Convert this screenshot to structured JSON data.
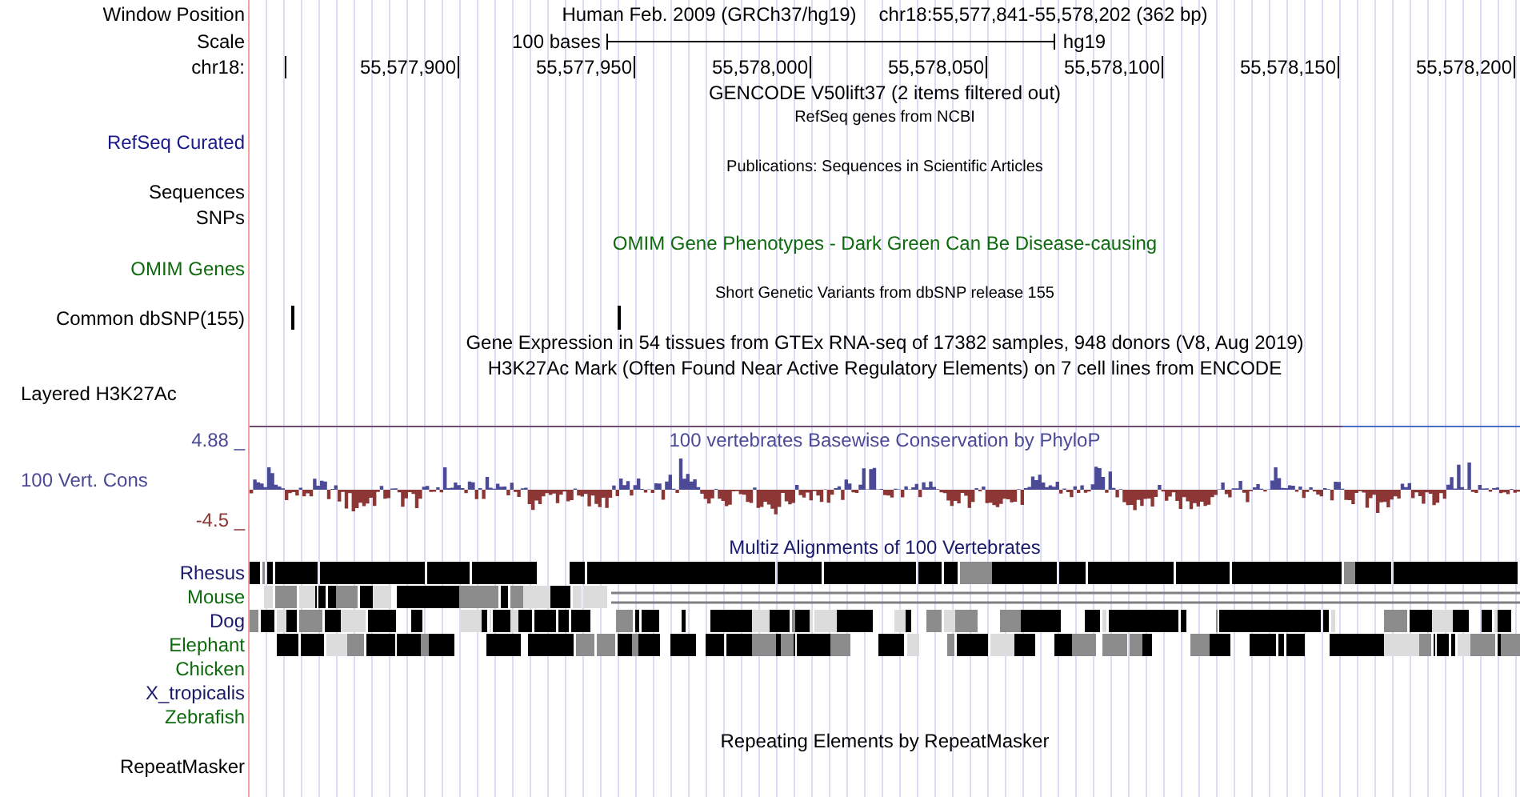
{
  "header": {
    "label": "Window Position",
    "assembly": "Human Feb. 2009 (GRCh37/hg19)",
    "position": "chr18:55,577,841-55,578,202 (362 bp)"
  },
  "scale": {
    "label": "Scale",
    "length": "100 bases",
    "db": "hg19"
  },
  "ruler": {
    "label": "chr18:",
    "ticks": [
      "55,577,900",
      "55,577,950",
      "55,578,000",
      "55,578,050",
      "55,578,100",
      "55,578,150",
      "55,578,200"
    ]
  },
  "rows": [
    {
      "kind": "title",
      "text": "GENCODE V50lift37 (2 items filtered out)",
      "color": "#000000"
    },
    {
      "kind": "subtitle",
      "text": "RefSeq genes from NCBI",
      "color": "#000000"
    },
    {
      "kind": "label",
      "label": "RefSeq Curated",
      "color": "#1a1a8c"
    },
    {
      "kind": "subtitle",
      "text": "Publications: Sequences in Scientific Articles",
      "color": "#000000"
    },
    {
      "kind": "label",
      "label": "Sequences",
      "color": "#000000"
    },
    {
      "kind": "label",
      "label": "SNPs",
      "color": "#000000"
    },
    {
      "kind": "title",
      "text": "OMIM Gene Phenotypes - Dark Green Can Be Disease-causing",
      "color": "#0d6b0d"
    },
    {
      "kind": "label",
      "label": "OMIM Genes",
      "color": "#0d6b0d"
    },
    {
      "kind": "subtitle",
      "text": "Short Genetic Variants from dbSNP release 155",
      "color": "#000000"
    },
    {
      "kind": "snp",
      "label": "Common dbSNP(155)",
      "color": "#000000"
    },
    {
      "kind": "title",
      "text": "Gene Expression in 54 tissues from GTEx RNA-seq of 17382 samples, 948 donors (V8, Aug 2019)",
      "color": "#000000"
    },
    {
      "kind": "title",
      "text": "H3K27Ac Mark (Often Found Near Active Regulatory Elements) on 7 cell lines from ENCODE",
      "color": "#000000"
    },
    {
      "kind": "composite",
      "label": "Layered H3K27Ac",
      "color": "#000000"
    },
    {
      "kind": "cons",
      "title": "100 vertebrates Basewise Conservation by PhyloP",
      "label": "100 Vert. Cons",
      "max": "4.88 _",
      "min": "-4.5 _",
      "color": "#4a4a96"
    },
    {
      "kind": "title",
      "text": "Multiz Alignments of 100 Vertebrates",
      "color": "#1a1a6b"
    },
    {
      "kind": "aligned",
      "label": "Rhesus",
      "color": "#1a1a6b"
    },
    {
      "kind": "gapped",
      "label": "Mouse",
      "color": "#0d6b0d"
    },
    {
      "kind": "aligned",
      "label": "Dog",
      "color": "#1a1a6b"
    },
    {
      "kind": "aligned",
      "label": "Elephant",
      "color": "#0d6b0d"
    },
    {
      "kind": "unaligned",
      "label": "Chicken",
      "color": "#0d6b0d"
    },
    {
      "kind": "unaligned",
      "label": "X_tropicalis",
      "color": "#1a1a6b"
    },
    {
      "kind": "unaligned",
      "label": "Zebrafish",
      "color": "#0d6b0d"
    },
    {
      "kind": "title",
      "text": "Repeating Elements by RepeatMasker",
      "color": "#000000"
    },
    {
      "kind": "label",
      "label": "RepeatMasker",
      "color": "#000000"
    }
  ]
}
